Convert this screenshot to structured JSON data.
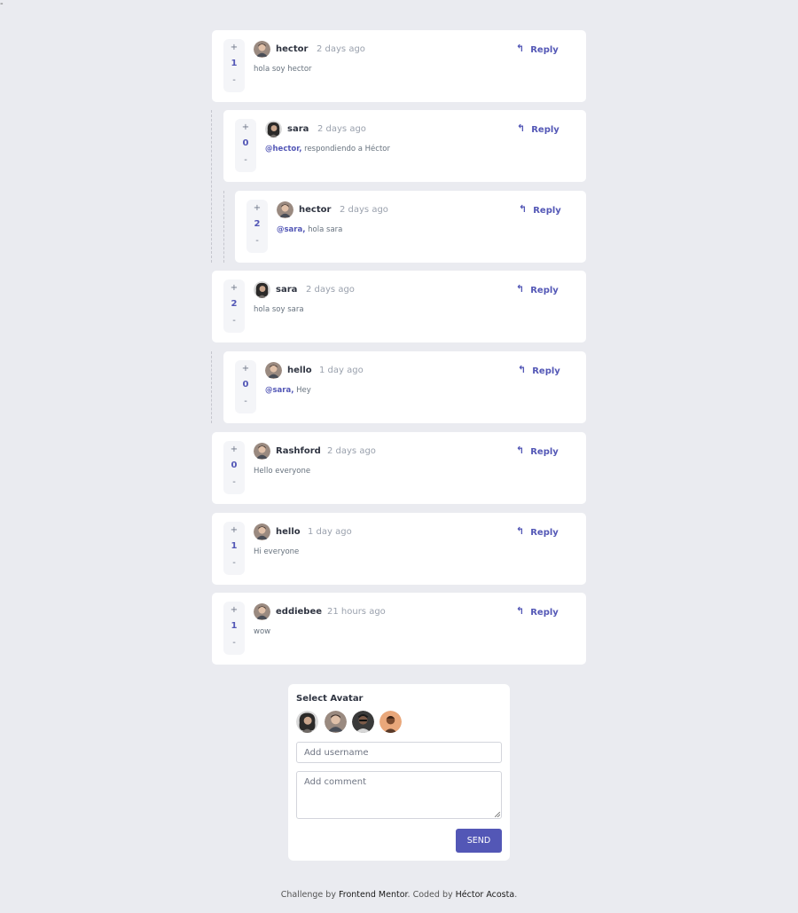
{
  "page": {
    "corner_mark": "-"
  },
  "comments": [
    {
      "score": "1",
      "username": "hector",
      "time": "2 days ago",
      "mention": "",
      "text": "hola soy hector",
      "avatar": "avatar-hector-icon",
      "reply_label": "Reply"
    },
    {
      "score": "0",
      "username": "sara",
      "time": "2 days ago",
      "mention": "@hector,",
      "text": " respondiendo a Héctor",
      "avatar": "avatar-sara-icon",
      "reply_label": "Reply"
    },
    {
      "score": "2",
      "username": "hector",
      "time": "2 days ago",
      "mention": "@sara,",
      "text": " hola sara",
      "avatar": "avatar-hector-icon",
      "reply_label": "Reply"
    },
    {
      "score": "2",
      "username": "sara",
      "time": "2 days ago",
      "mention": "",
      "text": "hola soy sara",
      "avatar": "avatar-sara-icon",
      "reply_label": "Reply"
    },
    {
      "score": "0",
      "username": "hello",
      "time": "1 day ago",
      "mention": "@sara,",
      "text": " Hey",
      "avatar": "avatar-hector-icon",
      "reply_label": "Reply"
    },
    {
      "score": "0",
      "username": "Rashford",
      "time": "2 days ago",
      "mention": "",
      "text": "Hello everyone",
      "avatar": "avatar-hector-icon",
      "reply_label": "Reply"
    },
    {
      "score": "1",
      "username": "hello",
      "time": "1 day ago",
      "mention": "",
      "text": "Hi everyone",
      "avatar": "avatar-hector-icon",
      "reply_label": "Reply"
    },
    {
      "score": "1",
      "username": "eddiebee",
      "time": "21 hours ago",
      "mention": "",
      "text": "wow",
      "avatar": "avatar-hector-icon",
      "reply_label": "Reply"
    }
  ],
  "vote": {
    "plus": "+",
    "minus": "-"
  },
  "form": {
    "title": "Select Avatar",
    "avatars": [
      "avatar-sara-icon",
      "avatar-hector-icon",
      "avatar-dark-icon",
      "avatar-orange-icon"
    ],
    "username_placeholder": "Add username",
    "username_value": "",
    "comment_placeholder": "Add comment",
    "comment_value": "",
    "send_label": "SEND"
  },
  "footer": {
    "prefix": "Challenge by ",
    "link1": "Frontend Mentor",
    "middle": ". Coded by ",
    "link2": "Héctor Acosta",
    "suffix": "."
  },
  "colors": {
    "accent": "#5357b6",
    "background": "#eaebf0",
    "card": "#ffffff",
    "username": "#2f3441",
    "muted": "#9aa1ad"
  }
}
